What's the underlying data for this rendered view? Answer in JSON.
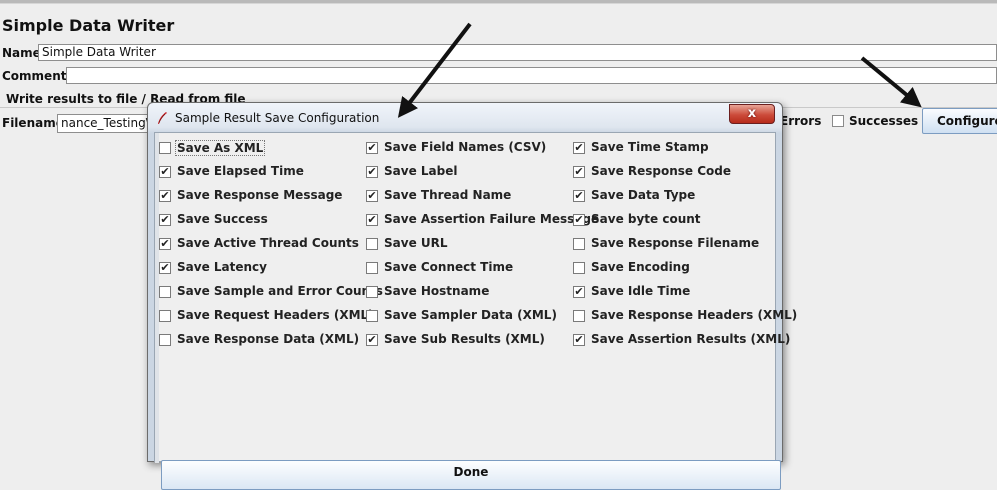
{
  "page": {
    "title": "Simple Data Writer",
    "name_label": "Name:",
    "name_value": "Simple Data Writer",
    "comments_label": "Comments:",
    "group_title": "Write results to file / Read from file",
    "filename_label": "Filename",
    "filename_value": "nance_Testing\\",
    "errors_label": "Errors",
    "successes_label": "Successes",
    "configure_button": "Configure"
  },
  "dialog": {
    "title": "Sample Result Save Configuration",
    "close_glyph": "x",
    "done_button": "Done",
    "columns": [
      [
        {
          "label": "Save As XML",
          "checked": false,
          "focused": true
        },
        {
          "label": "Save Elapsed Time",
          "checked": true
        },
        {
          "label": "Save Response Message",
          "checked": true
        },
        {
          "label": "Save Success",
          "checked": true
        },
        {
          "label": "Save Active Thread Counts",
          "checked": true
        },
        {
          "label": "Save Latency",
          "checked": true
        },
        {
          "label": "Save Sample and Error Counts",
          "checked": false
        },
        {
          "label": "Save Request Headers (XML)",
          "checked": false
        },
        {
          "label": "Save Response Data (XML)",
          "checked": false
        }
      ],
      [
        {
          "label": "Save Field Names (CSV)",
          "checked": true
        },
        {
          "label": "Save Label",
          "checked": true
        },
        {
          "label": "Save Thread Name",
          "checked": true
        },
        {
          "label": "Save Assertion Failure Message",
          "checked": true
        },
        {
          "label": "Save URL",
          "checked": false
        },
        {
          "label": "Save Connect Time",
          "checked": false
        },
        {
          "label": "Save Hostname",
          "checked": false
        },
        {
          "label": "Save Sampler Data (XML)",
          "checked": false
        },
        {
          "label": "Save Sub Results (XML)",
          "checked": true
        }
      ],
      [
        {
          "label": "Save Time Stamp",
          "checked": true
        },
        {
          "label": "Save Response Code",
          "checked": true
        },
        {
          "label": "Save Data Type",
          "checked": true
        },
        {
          "label": "Save byte count",
          "checked": true
        },
        {
          "label": "Save Response Filename",
          "checked": false
        },
        {
          "label": "Save Encoding",
          "checked": false
        },
        {
          "label": "Save Idle Time",
          "checked": true
        },
        {
          "label": "Save Response Headers (XML)",
          "checked": false
        },
        {
          "label": "Save Assertion Results (XML)",
          "checked": true
        }
      ]
    ]
  },
  "colors": {
    "background": "#eeeeee",
    "close_button": "#c8412f",
    "button_border": "#7c9cc1",
    "arrow": "#111111"
  },
  "icons": {
    "dialog_icon": "java-feather-icon",
    "annotation": "black-arrow-icon"
  }
}
